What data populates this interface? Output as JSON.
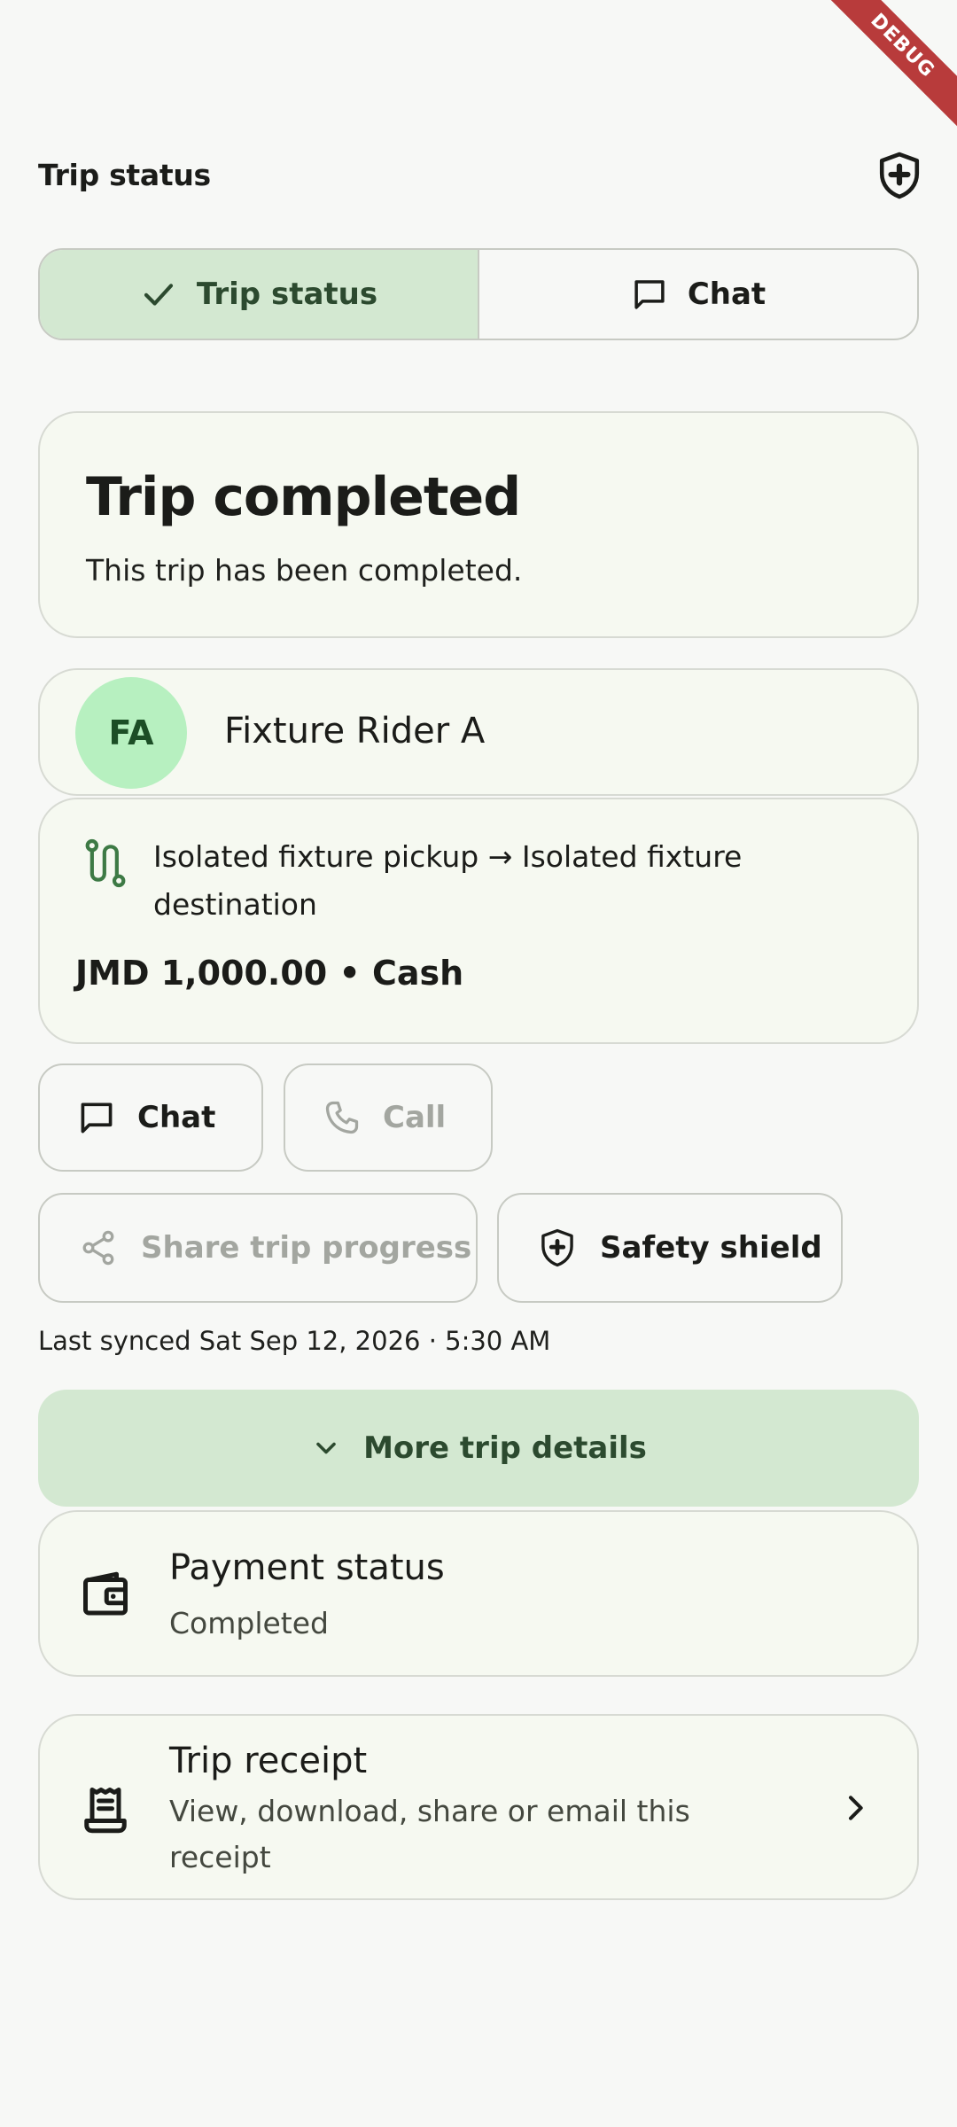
{
  "debug_banner": "DEBUG",
  "app_bar": {
    "title": "Trip status"
  },
  "tabs": [
    {
      "label": "Trip status",
      "active": true
    },
    {
      "label": "Chat",
      "active": false
    }
  ],
  "status_card": {
    "title": "Trip completed",
    "subtitle": "This trip has been completed."
  },
  "rider": {
    "initials": "FA",
    "name": "Fixture Rider A"
  },
  "trip": {
    "route": "Isolated fixture pickup → Isolated fixture destination",
    "fare": "JMD 1,000.00 • Cash"
  },
  "actions": {
    "chat": "Chat",
    "call": "Call",
    "share": "Share trip progress",
    "safety": "Safety shield"
  },
  "last_synced": "Last synced Sat Sep 12, 2026 · 5:30 AM",
  "more_details": "More trip details",
  "payment": {
    "title": "Payment status",
    "value": "Completed"
  },
  "receipt": {
    "title": "Trip receipt",
    "subtitle": "View, download, share or email this receipt"
  },
  "colors": {
    "accent": "#d3e8d1",
    "card": "#f6f9f1",
    "avatar": "#b7f0c0",
    "route_icon": "#3d7a45"
  }
}
